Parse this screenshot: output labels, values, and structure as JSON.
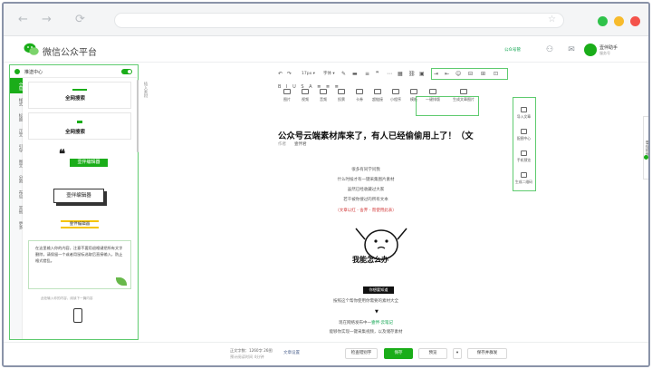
{
  "browser": {
    "back": "←",
    "forward": "→",
    "reload": "⟳",
    "star": "☆",
    "dots": [
      "#2fc24a",
      "#f7bb2c",
      "#f4534b"
    ]
  },
  "header": {
    "logo_text": "微信公众平台",
    "link": "公众号管",
    "user_name": "壹伴助手",
    "user_sub": "服务号"
  },
  "left_panel": {
    "title": "推送中心",
    "tabs": [
      "全局",
      "样式",
      "标题",
      "正文",
      "引导",
      "图文",
      "分割",
      "布局",
      "其他",
      "更多"
    ],
    "card1_label": "全网搜索",
    "card2_label": "全网搜索",
    "card3_btn": "壹伴编辑器",
    "card4_label": "壹伴编辑器",
    "card5_tag": "壹伴编辑器",
    "para": "在这里输入你的内容，注意不要用退格键把所有文字删除，请保留一个或者用鼠标选取后直接输入，防止格式错乱。",
    "small_note": "此处输入你的内容，阅读下一篇内容"
  },
  "insert_hint": "插入素材",
  "toolbar2": [
    {
      "label": "图片"
    },
    {
      "label": "视频"
    },
    {
      "label": "音频"
    },
    {
      "label": "投票"
    },
    {
      "label": "卡券"
    },
    {
      "label": "超链接"
    },
    {
      "label": "小程序"
    },
    {
      "label": "模板"
    },
    {
      "label": "一键排版"
    },
    {
      "label": "生成文章图片"
    }
  ],
  "right_tools": [
    {
      "label": "导入文章"
    },
    {
      "label": "配图中心"
    },
    {
      "label": "手机预览"
    },
    {
      "label": "生成二维码"
    }
  ],
  "side_tab": "壹伴插件",
  "article": {
    "title": "公众号云端素材库来了，有人已经偷偷用上了！（文",
    "meta_label": "作者",
    "author": "壹伴君",
    "lines": [
      "很多有同学问我",
      "什么时候才有一键采集图片素材",
      "虽然已经收藏过大家",
      "若干被你搜过的所有文本",
      "（文章以红 - 舍弃 - 而使用此表）"
    ],
    "meme_caption": "我能怎么办",
    "black_tag": "你想要知道",
    "after_lines": [
      "按照这个帮你使用你需要的素材大全"
    ],
    "line_a_pre": "现在网络发布中一",
    "line_a_hl": "壹伴·云笔记",
    "line_b": "能够你实现一键采集视频，以及储存素材",
    "arrow": "▼"
  },
  "bottom": {
    "word_count": "正文字数：1260字 26图",
    "word_count2": "预计阅读时间 4分钟",
    "settings": "文章设置",
    "btn_check": "检查错别字",
    "btn_save": "保存",
    "btn_preview": "预览",
    "btn_publish": "保存并群发"
  }
}
